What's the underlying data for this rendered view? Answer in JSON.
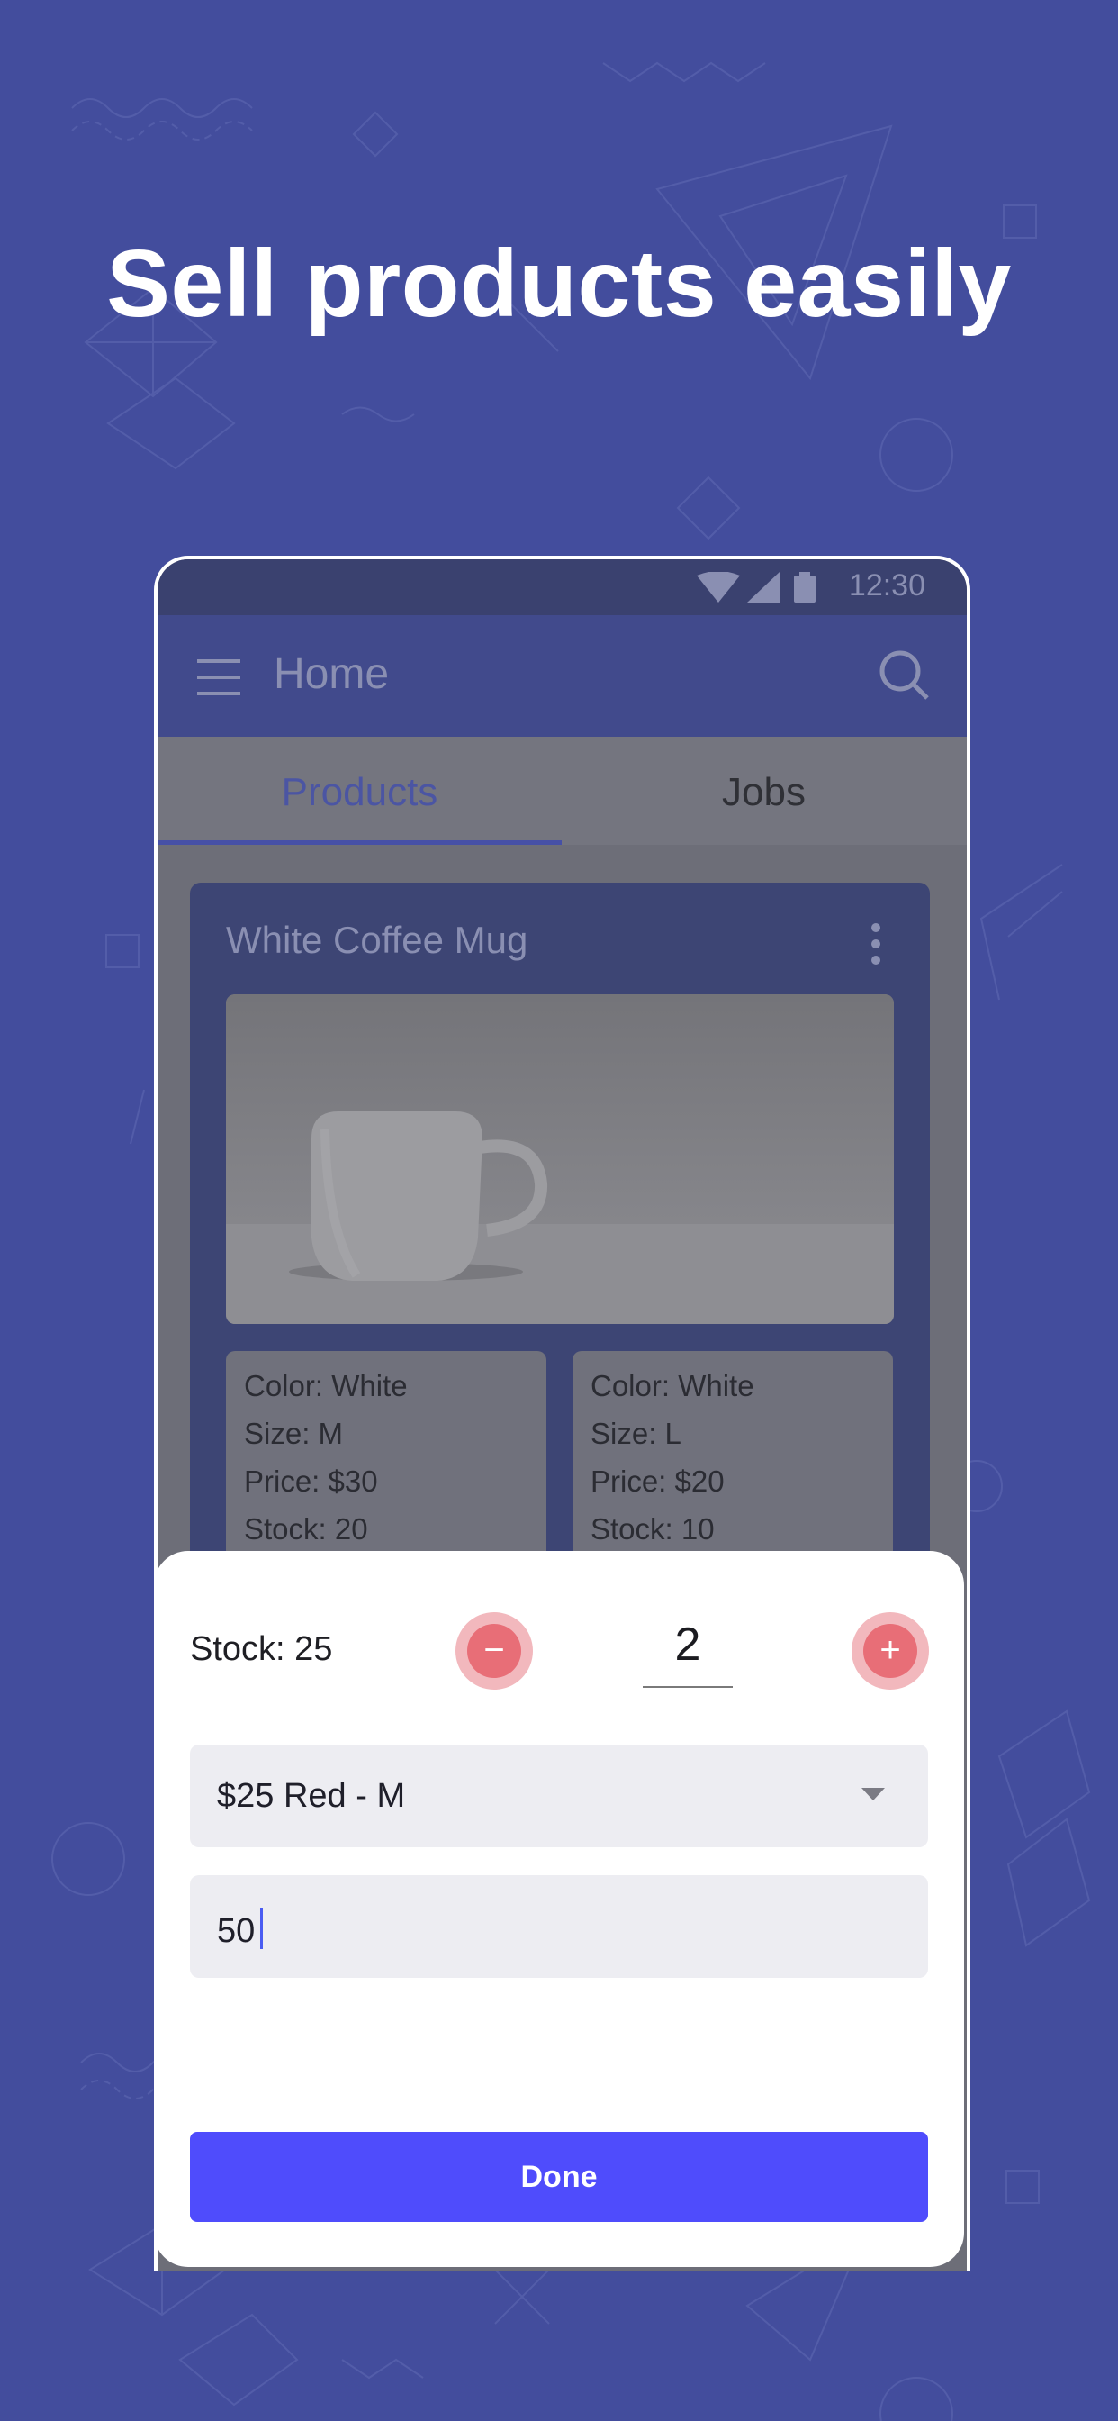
{
  "headline": "Sell products easily",
  "status_bar": {
    "time": "12:30",
    "icons": [
      "wifi-icon",
      "signal-icon",
      "battery-icon"
    ]
  },
  "app_bar": {
    "title": "Home",
    "menu_icon": "menu-icon",
    "search_icon": "search-icon"
  },
  "tabs": [
    {
      "label": "Products",
      "active": true
    },
    {
      "label": "Jobs",
      "active": false
    }
  ],
  "product": {
    "title": "White Coffee Mug",
    "image": "coffee-mug-photo",
    "variants": [
      {
        "color": "Color: White",
        "size": "Size: M",
        "price": "Price: $30",
        "stock": "Stock: 20"
      },
      {
        "color": "Color: White",
        "size": "Size: L",
        "price": "Price: $20",
        "stock": "Stock: 10"
      }
    ]
  },
  "sheet": {
    "stock_label": "Stock: 25",
    "quantity": "2",
    "minus_symbol": "−",
    "plus_symbol": "+",
    "variant_select_value": "$25 Red - M",
    "amount_input_value": "50",
    "done_label": "Done"
  },
  "colors": {
    "background": "#434d9d",
    "accent": "#4f4cfc",
    "stepper": "#e86e77",
    "white": "#ffffff"
  }
}
